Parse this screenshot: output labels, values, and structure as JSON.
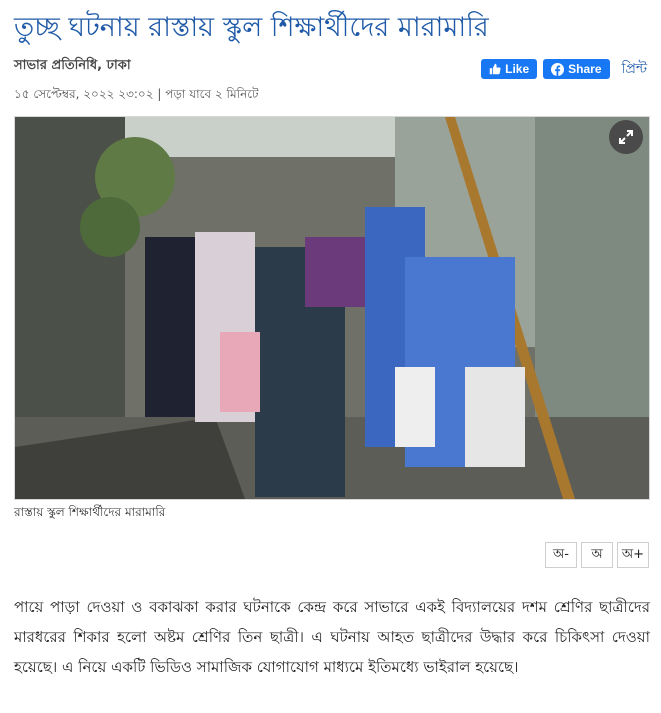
{
  "article": {
    "headline": "তুচ্ছ ঘটনায় রাস্তায় স্কুল শিক্ষার্থীদের মারামারি",
    "byline": "সাভার প্রতিনিধি, ঢাকা",
    "published": "১৫ সেপ্টেম্বর, ২০২২ ২৩:০২",
    "read_time": "পড়া যাবে ২ মিনিটে",
    "image_caption": "রাস্তায় স্কুল শিক্ষার্থীদের মারামারি",
    "body": "পায়ে পাড়া দেওয়া ও বকাঝকা করার ঘটনাকে কেন্দ্র করে সাভারে একই বিদ্যালয়ের দশম শ্রেণির ছাত্রীদের মারধরের শিকার হলো অষ্টম শ্রেণির তিন ছাত্রী। এ ঘটনায় আহত ছাত্রীদের উদ্ধার করে চিকিৎসা দেওয়া হয়েছে। এ নিয়ে একটি ভিডিও সামাজিক যোগাযোগ মাধ্যমে ইতিমধ্যে ভাইরাল হয়েছে।"
  },
  "social": {
    "like_label": "Like",
    "share_label": "Share",
    "print_label": "প্রিন্ট",
    "facebook_color": "#1877f2"
  },
  "font_size_controls": {
    "decrease_label": "অ-",
    "default_label": "অ",
    "increase_label": "অ+"
  },
  "icons": {
    "like": "thumbs-up-icon",
    "share": "facebook-icon",
    "expand": "expand-arrows-icon"
  },
  "colors": {
    "headline": "#1f5aa8",
    "link": "#1f5aa8"
  }
}
